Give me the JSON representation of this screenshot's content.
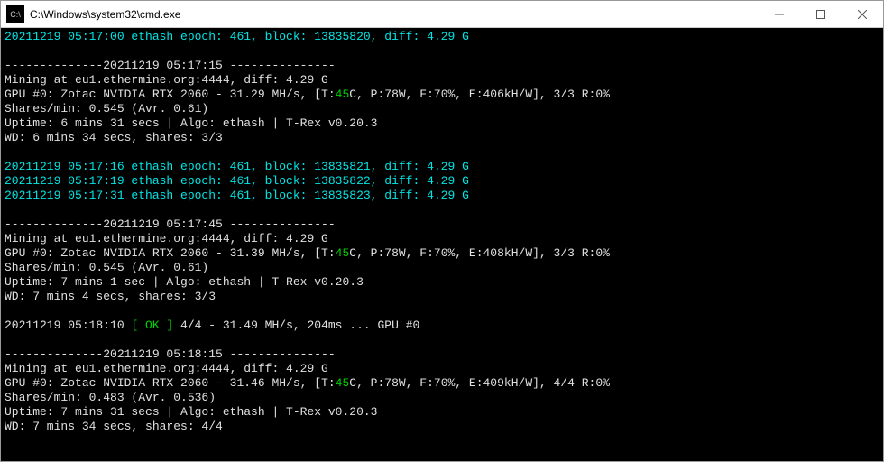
{
  "titlebar": {
    "icon_label": "C:\\",
    "title": "C:\\Windows\\system32\\cmd.exe"
  },
  "epoch1": "20211219 05:17:00 ethash epoch: 461, block: 13835820, diff: 4.29 G",
  "sep1_pre": "--------------",
  "sep1_ts": "20211219 05:17:15",
  "sep1_post": " ---------------",
  "block1": {
    "mining": "Mining at eu1.ethermine.org:4444, diff: 4.29 G",
    "gpu_pre": "GPU #0: Zotac NVIDIA RTX 2060 - 31.29 MH/s, [T:",
    "gpu_temp": "45",
    "gpu_post": "C, P:78W, F:70%, E:406kH/W], 3/3 R:0%",
    "shares": "Shares/min: 0.545 (Avr. 0.61)",
    "uptime": "Uptime: 6 mins 31 secs | Algo: ethash | T-Rex v0.20.3",
    "wd": "WD: 6 mins 34 secs, shares: 3/3"
  },
  "epoch2a": "20211219 05:17:16 ethash epoch: 461, block: 13835821, diff: 4.29 G",
  "epoch2b": "20211219 05:17:19 ethash epoch: 461, block: 13835822, diff: 4.29 G",
  "epoch2c": "20211219 05:17:31 ethash epoch: 461, block: 13835823, diff: 4.29 G",
  "sep2_pre": "--------------",
  "sep2_ts": "20211219 05:17:45",
  "sep2_post": " ---------------",
  "block2": {
    "mining": "Mining at eu1.ethermine.org:4444, diff: 4.29 G",
    "gpu_pre": "GPU #0: Zotac NVIDIA RTX 2060 - 31.39 MH/s, [T:",
    "gpu_temp": "45",
    "gpu_post": "C, P:78W, F:70%, E:408kH/W], 3/3 R:0%",
    "shares": "Shares/min: 0.545 (Avr. 0.61)",
    "uptime": "Uptime: 7 mins 1 sec | Algo: ethash | T-Rex v0.20.3",
    "wd": "WD: 7 mins 4 secs, shares: 3/3"
  },
  "share": {
    "ts": "20211219 05:18:10 ",
    "ok": "[ OK ]",
    "rest": " 4/4 - 31.49 MH/s, 204ms ... GPU #0"
  },
  "sep3_pre": "--------------",
  "sep3_ts": "20211219 05:18:15",
  "sep3_post": " ---------------",
  "block3": {
    "mining": "Mining at eu1.ethermine.org:4444, diff: 4.29 G",
    "gpu_pre": "GPU #0: Zotac NVIDIA RTX 2060 - 31.46 MH/s, [T:",
    "gpu_temp": "45",
    "gpu_post": "C, P:78W, F:70%, E:409kH/W], 4/4 R:0%",
    "shares": "Shares/min: 0.483 (Avr. 0.536)",
    "uptime": "Uptime: 7 mins 31 secs | Algo: ethash | T-Rex v0.20.3",
    "wd": "WD: 7 mins 34 secs, shares: 4/4"
  }
}
